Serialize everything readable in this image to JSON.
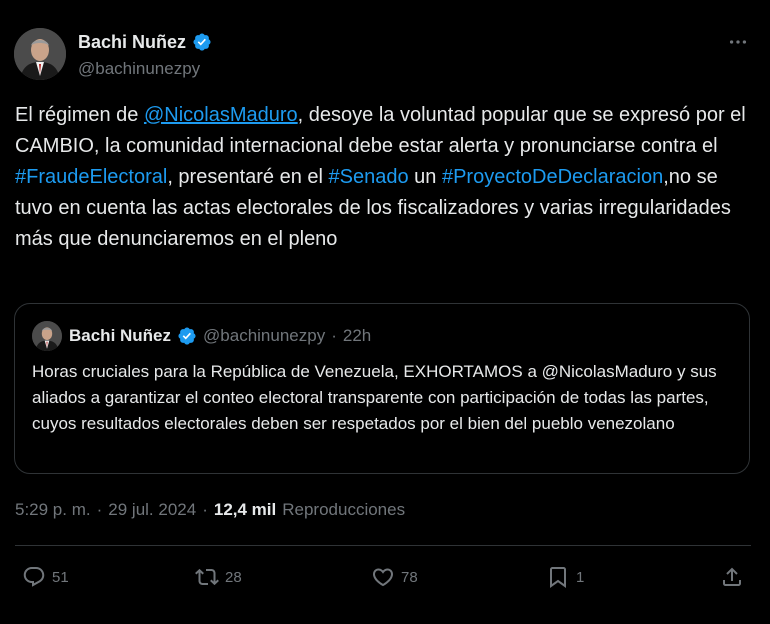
{
  "author": {
    "name": "Bachi Nuñez",
    "handle": "@bachinunezpy"
  },
  "tweet": {
    "segments": [
      {
        "t": "text",
        "v": "El régimen de "
      },
      {
        "t": "mention",
        "v": "@NicolasMaduro"
      },
      {
        "t": "text",
        "v": ", desoye la voluntad popular que se expresó por el CAMBIO, la comunidad internacional debe estar alerta y pronunciarse contra el "
      },
      {
        "t": "hashtag",
        "v": "#FraudeElectoral"
      },
      {
        "t": "text",
        "v": ", presentaré  en el "
      },
      {
        "t": "hashtag",
        "v": "#Senado"
      },
      {
        "t": "text",
        "v": " un "
      },
      {
        "t": "hashtag",
        "v": "#ProyectoDeDeclaracion"
      },
      {
        "t": "text",
        "v": ",no se tuvo en cuenta las actas electorales de los fiscalizadores y varias irregularidades más que denunciaremos en el pleno"
      }
    ]
  },
  "quote": {
    "name": "Bachi Nuñez",
    "handle": "@bachinunezpy",
    "separator": "·",
    "time": "22h",
    "text": "Horas cruciales para la República  de Venezuela, EXHORTAMOS a @NicolasMaduro y sus aliados a garantizar el conteo electoral transparente con participación de todas las partes, cuyos resultados electorales deben ser respetados por el bien del pueblo venezolano"
  },
  "meta": {
    "time": "5:29 p. m.",
    "sep1": "·",
    "date": "29 jul. 2024",
    "sep2": "·",
    "views": "12,4 mil",
    "views_label": "Reproducciones"
  },
  "actions": {
    "replies": "51",
    "retweets": "28",
    "likes": "78",
    "bookmarks": "1"
  },
  "icons": {
    "verified": "verified-badge-icon",
    "more": "more-icon",
    "reply": "reply-icon",
    "retweet": "retweet-icon",
    "like": "heart-icon",
    "bookmark": "bookmark-icon",
    "share": "share-icon"
  },
  "colors": {
    "background": "#000000",
    "text": "#e7e9ea",
    "muted": "#71767b",
    "link": "#1d9bf0",
    "border": "#2f3336"
  }
}
